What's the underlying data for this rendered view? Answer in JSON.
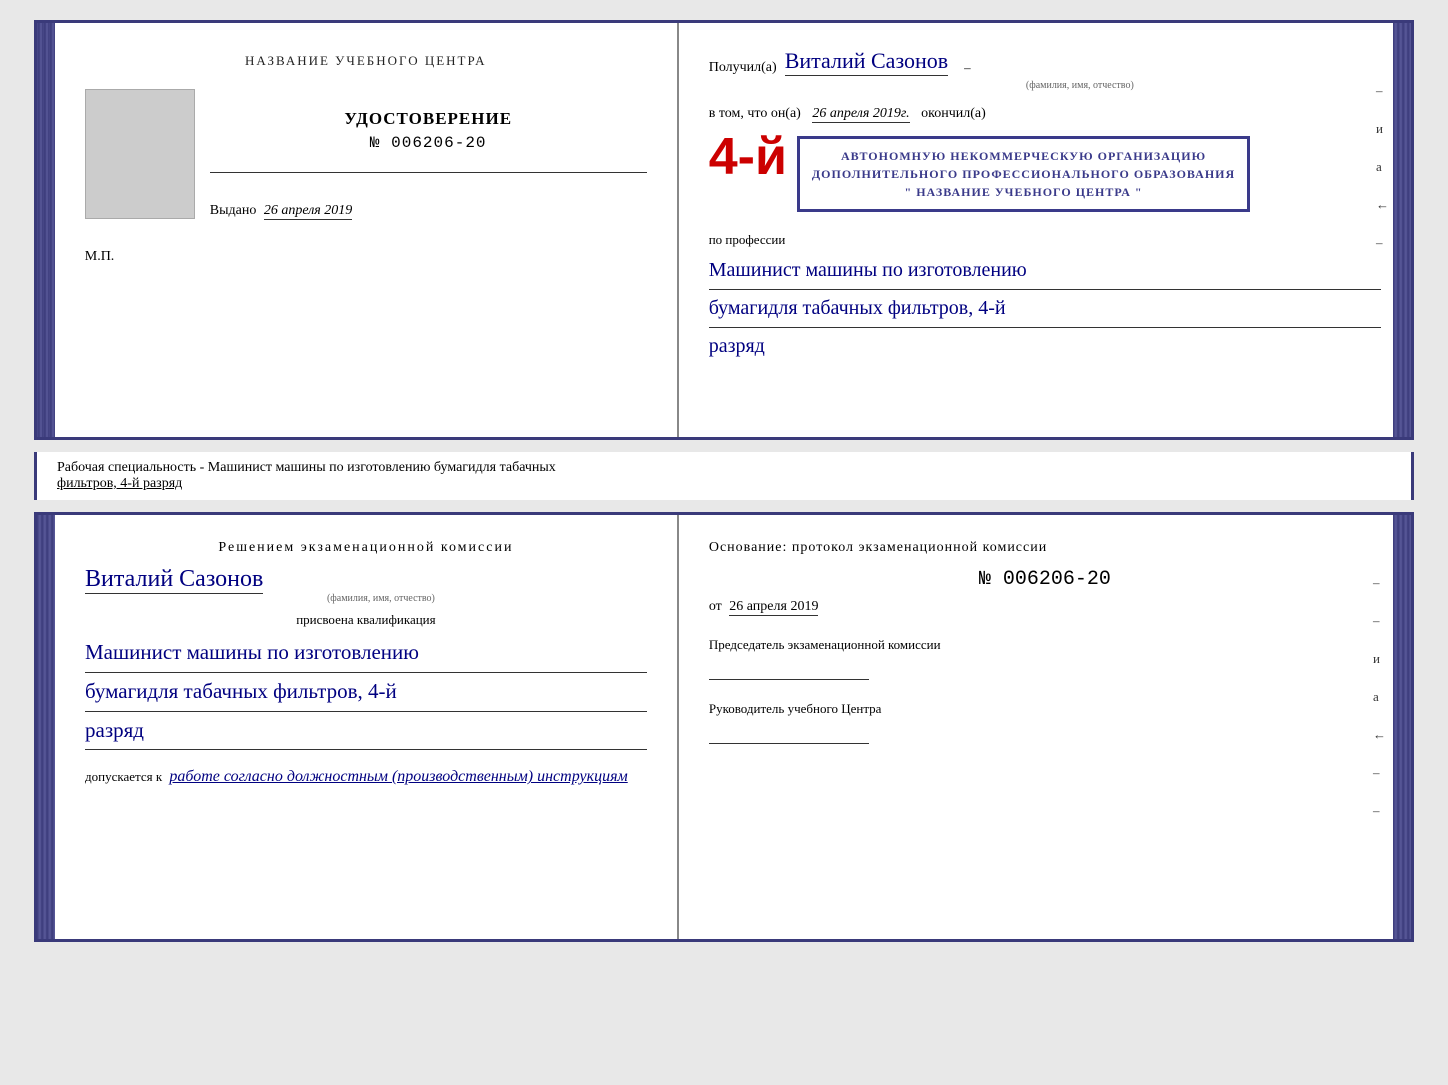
{
  "top_left": {
    "training_center_label": "НАЗВАНИЕ УЧЕБНОГО ЦЕНТРА",
    "cert_title": "УДОСТОВЕРЕНИЕ",
    "cert_number": "№ 006206-20",
    "issued_label": "Выдано",
    "issued_date": "26 апреля 2019",
    "mp_label": "М.П."
  },
  "top_right": {
    "received_label": "Получил(а)",
    "recipient_name": "Виталий Сазонов",
    "recipient_subtitle": "(фамилия, имя, отчество)",
    "in_that_prefix": "в том, что он(а)",
    "in_that_date": "26 апреля 2019г.",
    "finished_label": "окончил(а)",
    "stamp_line1": "АВТОНОМНУЮ НЕКОММЕРЧЕСКУЮ ОРГАНИЗАЦИЮ",
    "stamp_line2": "ДОПОЛНИТЕЛЬНОГО ПРОФЕССИОНАЛЬНОГО ОБРАЗОВАНИЯ",
    "stamp_line3": "\" НАЗВАНИЕ УЧЕБНОГО ЦЕНТРА \"",
    "big_number": "4-й",
    "profession_label": "по профессии",
    "profession_line1": "Машинист машины по изготовлению",
    "profession_line2": "бумагидля табачных фильтров, 4-й",
    "profession_line3": "разряд"
  },
  "description": {
    "text": "Рабочая специальность - Машинист машины по изготовлению бумагидля табачных",
    "underline_text": "фильтров, 4-й разряд"
  },
  "bottom_left": {
    "commission_title": "Решением экзаменационной комиссии",
    "person_name": "Виталий Сазонов",
    "person_subtitle": "(фамилия, имя, отчество)",
    "assigned_text": "присвоена квалификация",
    "qualification_line1": "Машинист машины по изготовлению",
    "qualification_line2": "бумагидля табачных фильтров, 4-й",
    "qualification_line3": "разряд",
    "allowed_prefix": "допускается к",
    "allowed_text": "работе согласно должностным (производственным) инструкциям"
  },
  "bottom_right": {
    "basis_text": "Основание: протокол экзаменационной комиссии",
    "protocol_number": "№  006206-20",
    "date_prefix": "от",
    "date_value": "26 апреля 2019",
    "chairman_title": "Председатель экзаменационной комиссии",
    "center_director_title": "Руководитель учебного Центра"
  },
  "side_chars": {
    "и": "и",
    "а": "а",
    "к": "←"
  }
}
